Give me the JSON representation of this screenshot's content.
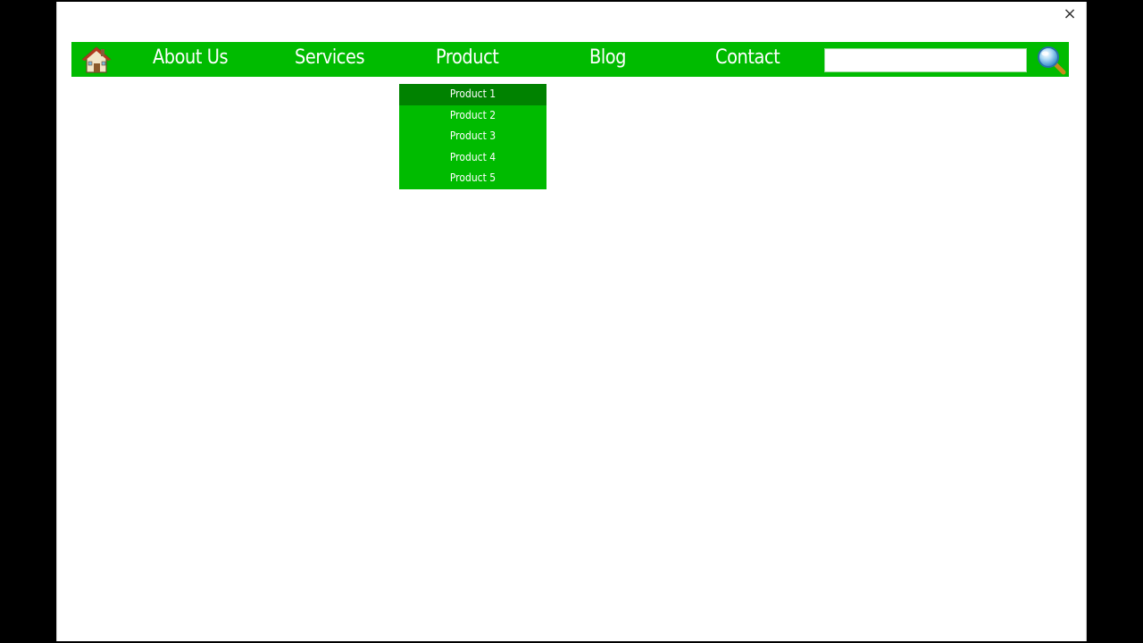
{
  "window": {
    "close_label": "×"
  },
  "navbar": {
    "home_icon": "home-icon",
    "items": [
      {
        "label": "About Us"
      },
      {
        "label": "Services"
      },
      {
        "label": "Product"
      },
      {
        "label": "Blog"
      },
      {
        "label": "Contact"
      }
    ],
    "search": {
      "value": "",
      "placeholder": ""
    },
    "search_icon": "magnifier-icon"
  },
  "dropdown": {
    "parent": "Product",
    "items": [
      {
        "label": "Product 1",
        "active": true
      },
      {
        "label": "Product 2",
        "active": false
      },
      {
        "label": "Product 3",
        "active": false
      },
      {
        "label": "Product 4",
        "active": false
      },
      {
        "label": "Product 5",
        "active": false
      }
    ]
  },
  "colors": {
    "nav_green": "#00bb00",
    "dropdown_active": "#008200",
    "text": "#ffffff",
    "background": "#ffffff",
    "outer": "#000000"
  }
}
